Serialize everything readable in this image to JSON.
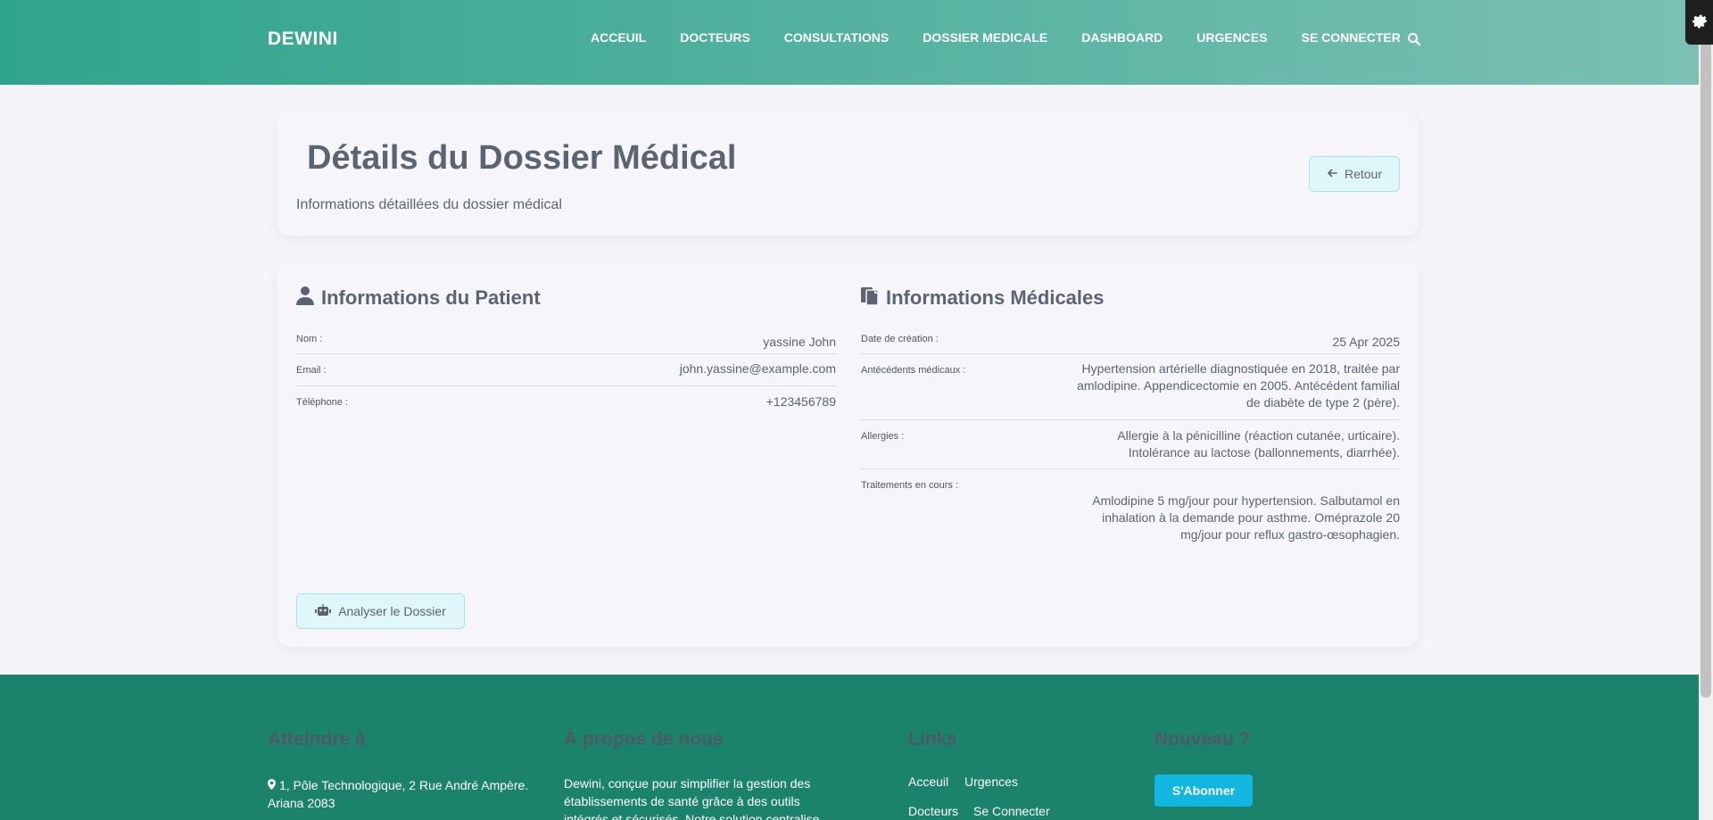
{
  "header": {
    "brand": "DEWINI",
    "nav": [
      "ACCEUIL",
      "DOCTEURS",
      "CONSULTATIONS",
      "DOSSIER MEDICALE",
      "DASHBOARD",
      "URGENCES",
      "SE CONNECTER"
    ]
  },
  "page": {
    "title": "Détails du Dossier Médical",
    "subtitle": "Informations détaillées du dossier médical",
    "back_button": "Retour"
  },
  "patient": {
    "heading": "Informations du Patient",
    "rows": [
      {
        "label": "Nom :",
        "value": "yassine John"
      },
      {
        "label": "Email :",
        "value": "john.yassine@example.com"
      },
      {
        "label": "Téléphone :",
        "value": "+123456789"
      }
    ]
  },
  "medical": {
    "heading": "Informations Médicales",
    "rows": [
      {
        "label": "Date de création :",
        "value": "25 Apr 2025"
      },
      {
        "label": "Antécédents médicaux :",
        "value": "Hypertension artérielle diagnostiquée en 2018, traitée par amlodipine. Appendicectomie en 2005. Antécédent familial de diabète de type 2 (père)."
      },
      {
        "label": "Allergies :",
        "value": "Allergie à la pénicilline (réaction cutanée, urticaire). Intolérance au lactose (ballonnements, diarrhée)."
      },
      {
        "label": "Traitements en cours :",
        "value": "Amlodipine 5 mg/jour pour hypertension. Salbutamol en inhalation à la demande pour asthme. Oméprazole 20 mg/jour pour reflux gastro-œsophagien."
      }
    ]
  },
  "analyse_button": "Analyser le Dossier",
  "footer": {
    "reach": {
      "heading": "Atteindre à",
      "address": "1, Pôle Technologique, 2 Rue André Ampère. Ariana 2083"
    },
    "about": {
      "heading": "À propos de nous",
      "text": "Dewini, conçue pour simplifier la gestion des établissements de santé grâce à des outils intégrés et sécurisés. Notre solution centralise"
    },
    "links": {
      "heading": "Links",
      "items": [
        "Acceuil",
        "Urgences",
        "Docteurs",
        "Se Connecter"
      ]
    },
    "newsletter": {
      "heading": "Nouveau ?",
      "button": "S'Abonner"
    }
  },
  "colors": {
    "header_start": "#2fa48c",
    "footer": "#1b826b",
    "accent_button": "#11b7df"
  }
}
